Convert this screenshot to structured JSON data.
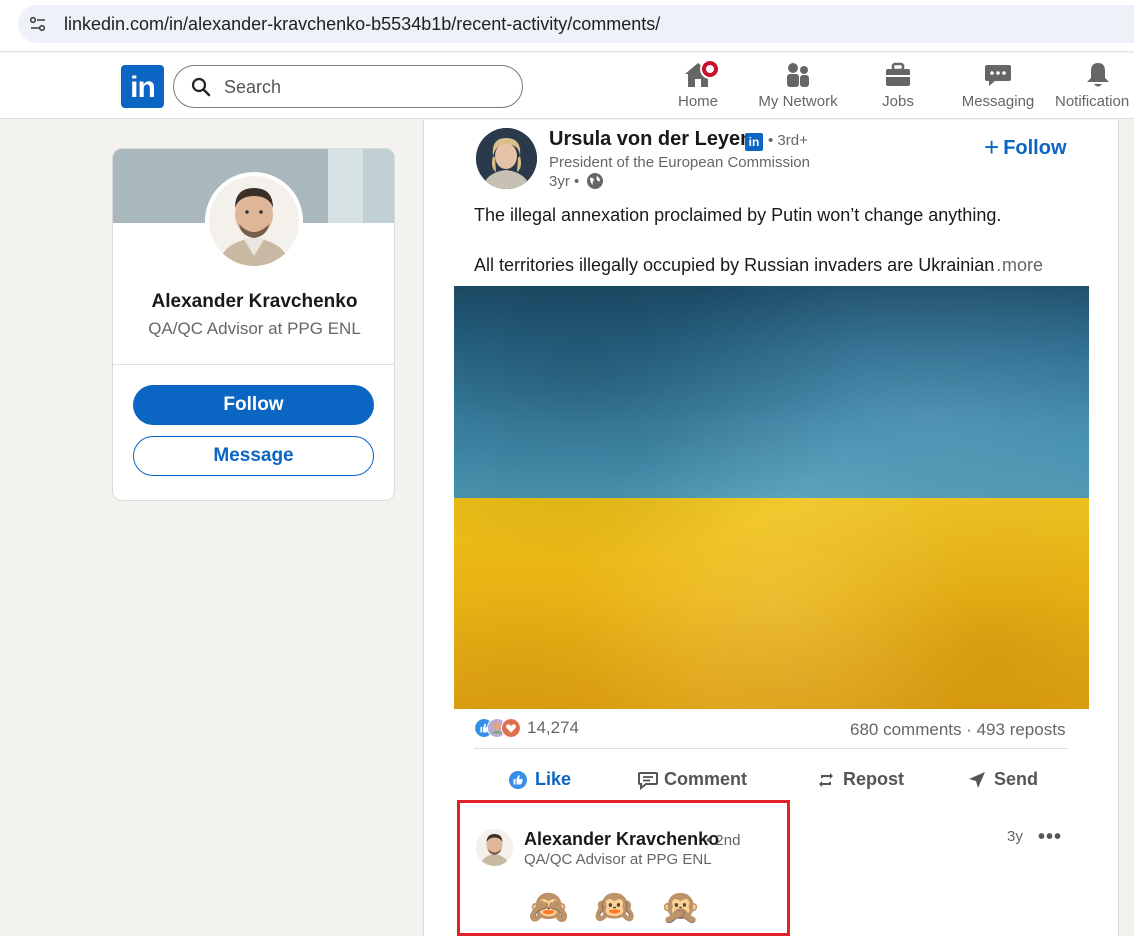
{
  "browser": {
    "url": "linkedin.com/in/alexander-kravchenko-b5534b1b/recent-activity/comments/"
  },
  "header": {
    "logo": "in",
    "search_placeholder": "Search",
    "nav": [
      {
        "label": "Home",
        "icon": "home-icon",
        "badge": true
      },
      {
        "label": "My Network",
        "icon": "network-icon"
      },
      {
        "label": "Jobs",
        "icon": "briefcase-icon"
      },
      {
        "label": "Messaging",
        "icon": "messaging-icon"
      },
      {
        "label": "Notification",
        "icon": "bell-icon"
      }
    ]
  },
  "profile": {
    "name": "Alexander Kravchenko",
    "headline": "QA/QC Advisor at PPG ENL",
    "follow_label": "Follow",
    "message_label": "Message"
  },
  "post": {
    "author": "Ursula von der Leyen",
    "badge": "in",
    "degree": "• 3rd+",
    "headline": "President of the European Commission",
    "time": "3yr •",
    "follow_label": "Follow",
    "text_line1": "The illegal annexation proclaimed by Putin won’t change anything.",
    "text_line2": "All territories illegally occupied by Russian invaders are Ukrainian",
    "more_label": "…more",
    "reaction_count": "14,274",
    "stats": "680 comments · 493 reposts",
    "actions": {
      "like": "Like",
      "comment": "Comment",
      "repost": "Repost",
      "send": "Send"
    }
  },
  "comment": {
    "name": "Alexander Kravchenko",
    "degree": "• 2nd",
    "headline": "QA/QC Advisor at PPG ENL",
    "time": "3y",
    "menu": "•••",
    "text": [
      "🙈",
      "🙉",
      "🙊"
    ]
  },
  "colors": {
    "brand": "#0a66c2",
    "highlight_border": "#e32028",
    "flag_blue": "#2a6b8e",
    "flag_yellow": "#f0c419"
  }
}
